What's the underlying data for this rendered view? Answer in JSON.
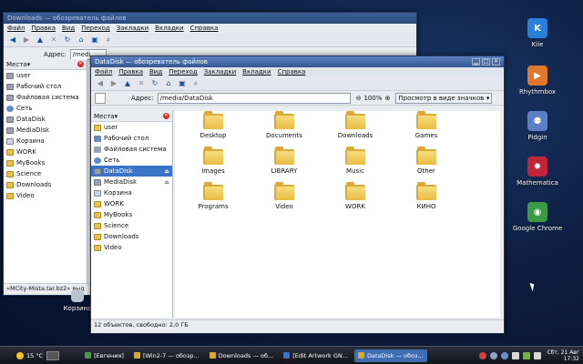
{
  "desktop": {
    "icons": [
      {
        "label": "Kile",
        "glyph": "K",
        "color": "#2a7fd8"
      },
      {
        "label": "Rhythmbox",
        "glyph": "▶",
        "color": "#e0772b"
      },
      {
        "label": "Pidgin",
        "glyph": "⚉",
        "color": "#5d7fc4"
      },
      {
        "label": "Mathematica",
        "glyph": "✹",
        "color": "#c0243b"
      },
      {
        "label": "Google Chrome",
        "glyph": "◉",
        "color": "#3a9a45"
      }
    ],
    "trash_label": "Корзина"
  },
  "back_window": {
    "title": "Downloads — обозреватель файлов",
    "menu": [
      "Файл",
      "Правка",
      "Вид",
      "Переход",
      "Закладки",
      "Вкладки",
      "Справка"
    ],
    "address_label": "Адрес:",
    "address_value": "/medi",
    "places_header": "Места",
    "places": [
      "user",
      "Рабочий стол",
      "Файловая система",
      "Сеть",
      "DataDisk",
      "MediaDisk",
      "Корзина",
      "WORK",
      "MyBooks",
      "Science",
      "Downloads",
      "Video"
    ],
    "status": "«MCity-Mista.tar.bz2» выд"
  },
  "front_window": {
    "title": "DataDisk — обозреватель файлов",
    "menu": [
      "Файл",
      "Правка",
      "Вид",
      "Переход",
      "Закладки",
      "Вкладки",
      "Справка"
    ],
    "address_label": "Адрес:",
    "address_value": "/media/DataDisk",
    "zoom": "100%",
    "view_mode": "Просмотр в виде значков",
    "places_header": "Места",
    "places": [
      {
        "label": "user",
        "icon": "home"
      },
      {
        "label": "Рабочий стол",
        "icon": "desk"
      },
      {
        "label": "Файловая система",
        "icon": "fs"
      },
      {
        "label": "Сеть",
        "icon": "net"
      },
      {
        "label": "DataDisk",
        "icon": "drive"
      },
      {
        "label": "MediaDisk",
        "icon": "drive"
      },
      {
        "label": "Корзина",
        "icon": "trash"
      },
      {
        "label": "WORK",
        "icon": "folder"
      },
      {
        "label": "MyBooks",
        "icon": "folder"
      },
      {
        "label": "Science",
        "icon": "folder"
      },
      {
        "label": "Downloads",
        "icon": "folder"
      },
      {
        "label": "Video",
        "icon": "folder"
      }
    ],
    "files": [
      "Desktop",
      "Documents",
      "Downloads",
      "Games",
      "Images",
      "LIBRARY",
      "Music",
      "Other",
      "Programs",
      "Video",
      "WORK",
      "КИНО"
    ],
    "status": "12 объектов, свободно: 2,0 ГБ"
  },
  "taskbar": {
    "weather": "15 °C",
    "tasks": [
      {
        "label": "[Евгения]",
        "color": "#4a9a4a"
      },
      {
        "label": "[Win2-7 — обозр...",
        "color": "#d8a82c"
      },
      {
        "label": "Downloads — об...",
        "color": "#d8a82c"
      },
      {
        "label": "[Edit Artwork GN...",
        "color": "#3b73c6"
      },
      {
        "label": "DataDisk — обоз...",
        "color": "#d8a82c"
      }
    ],
    "date": "Сбт, 21 Авг",
    "time": "17:32"
  }
}
